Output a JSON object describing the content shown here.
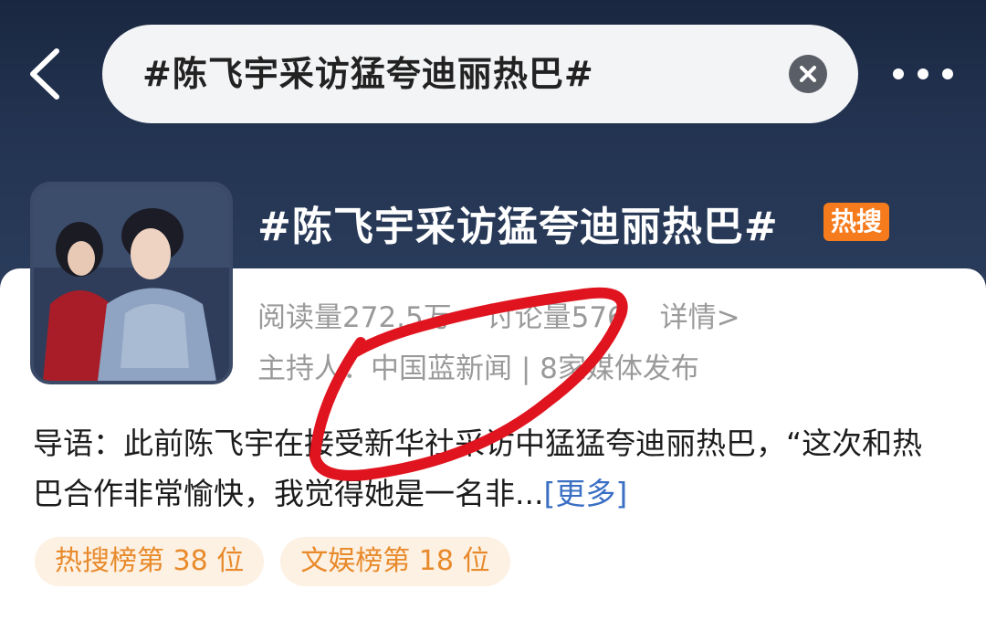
{
  "header": {
    "search_query": "#陈飞宇采访猛夸迪丽热巴#"
  },
  "topic": {
    "title": "#陈飞宇采访猛夸迪丽热巴#",
    "badge": "热搜",
    "reads": "阅读量272.5万",
    "discussions": "讨论量576",
    "details": "详情>",
    "host": "主持人：中国蓝新闻 | 8家媒体发布"
  },
  "intro": {
    "text": "导语：此前陈飞宇在接受新华社采访中猛猛夸迪丽热巴，“这次和热巴合作非常愉快，我觉得她是一名非...",
    "more": "[更多]"
  },
  "tags": [
    "热搜榜第 38 位",
    "文娱榜第 18 位"
  ],
  "colors": {
    "header_bg": "#1f2d47",
    "badge": "#f57b1c",
    "tag_text": "#e88a2b",
    "tag_bg": "#fdf1e3",
    "link": "#3a6fc4",
    "annotation": "#e0141e"
  },
  "icons": [
    "back-arrow-icon",
    "clear-icon",
    "more-icon"
  ]
}
